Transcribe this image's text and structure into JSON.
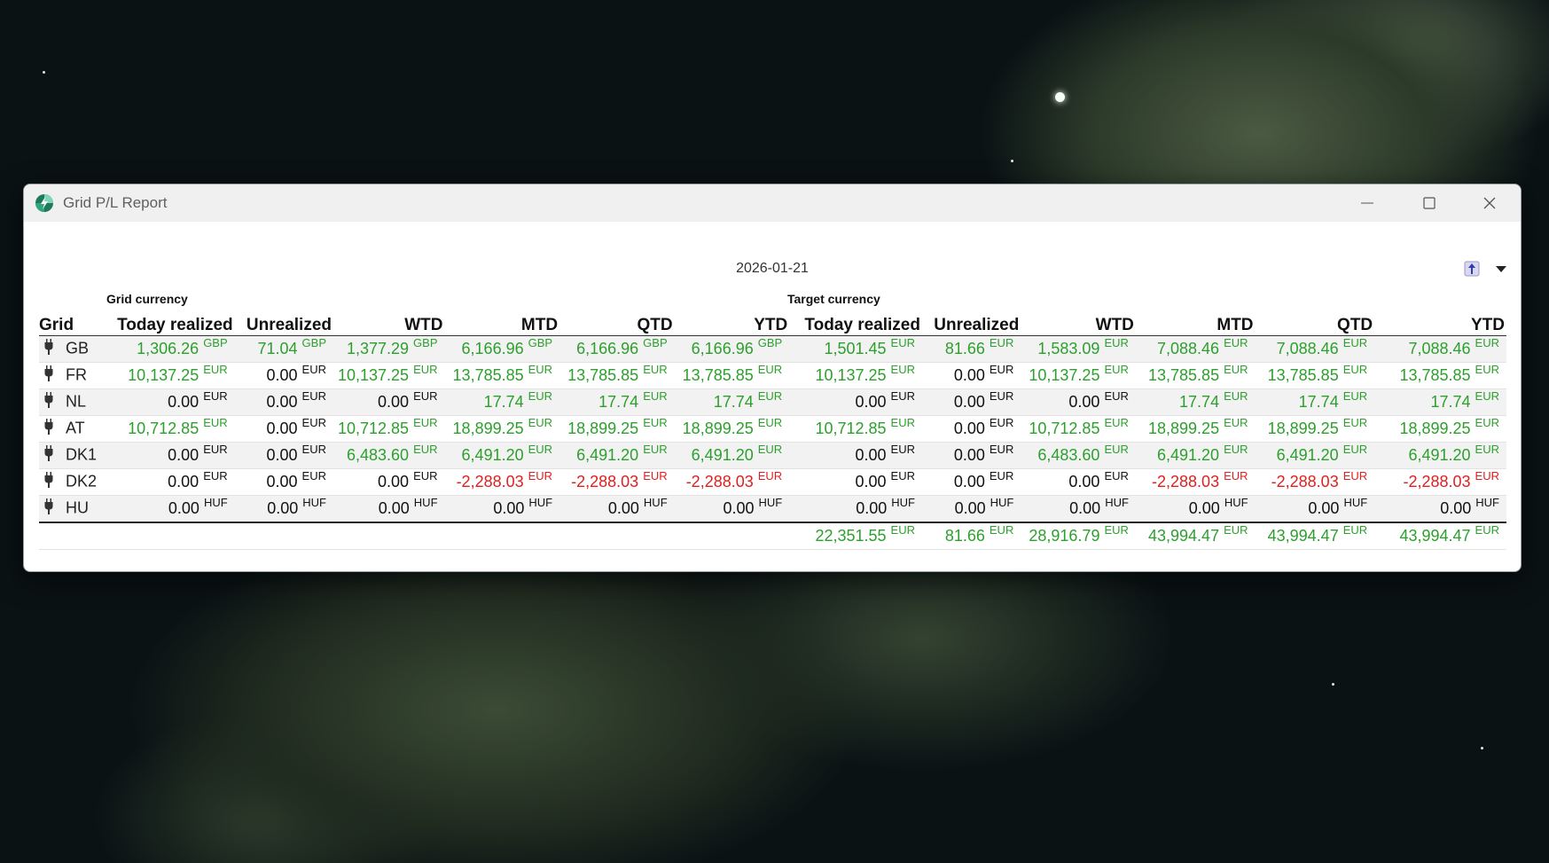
{
  "window": {
    "title": "Grid P/L Report"
  },
  "report_date": "2026-01-21",
  "groups": {
    "grid_currency": "Grid currency",
    "target_currency": "Target currency"
  },
  "columns": [
    "Grid",
    "Today realized",
    "Unrealized",
    "WTD",
    "MTD",
    "QTD",
    "YTD",
    "Today realized",
    "Unrealized",
    "WTD",
    "MTD",
    "QTD",
    "YTD"
  ],
  "colors": {
    "positive": "#2ca02c",
    "negative": "#e02020",
    "zero": "#111111"
  },
  "rows": [
    {
      "grid": "GB",
      "gc": "GBP",
      "tc": "EUR",
      "values": [
        "1,306.26",
        "71.04",
        "1,377.29",
        "6,166.96",
        "6,166.96",
        "6,166.96",
        "1,501.45",
        "81.66",
        "1,583.09",
        "7,088.46",
        "7,088.46",
        "7,088.46"
      ]
    },
    {
      "grid": "FR",
      "gc": "EUR",
      "tc": "EUR",
      "values": [
        "10,137.25",
        "0.00",
        "10,137.25",
        "13,785.85",
        "13,785.85",
        "13,785.85",
        "10,137.25",
        "0.00",
        "10,137.25",
        "13,785.85",
        "13,785.85",
        "13,785.85"
      ]
    },
    {
      "grid": "NL",
      "gc": "EUR",
      "tc": "EUR",
      "values": [
        "0.00",
        "0.00",
        "0.00",
        "17.74",
        "17.74",
        "17.74",
        "0.00",
        "0.00",
        "0.00",
        "17.74",
        "17.74",
        "17.74"
      ]
    },
    {
      "grid": "AT",
      "gc": "EUR",
      "tc": "EUR",
      "values": [
        "10,712.85",
        "0.00",
        "10,712.85",
        "18,899.25",
        "18,899.25",
        "18,899.25",
        "10,712.85",
        "0.00",
        "10,712.85",
        "18,899.25",
        "18,899.25",
        "18,899.25"
      ]
    },
    {
      "grid": "DK1",
      "gc": "EUR",
      "tc": "EUR",
      "values": [
        "0.00",
        "0.00",
        "6,483.60",
        "6,491.20",
        "6,491.20",
        "6,491.20",
        "0.00",
        "0.00",
        "6,483.60",
        "6,491.20",
        "6,491.20",
        "6,491.20"
      ]
    },
    {
      "grid": "DK2",
      "gc": "EUR",
      "tc": "EUR",
      "values": [
        "0.00",
        "0.00",
        "0.00",
        "-2,288.03",
        "-2,288.03",
        "-2,288.03",
        "0.00",
        "0.00",
        "0.00",
        "-2,288.03",
        "-2,288.03",
        "-2,288.03"
      ]
    },
    {
      "grid": "HU",
      "gc": "HUF",
      "tc": "HUF",
      "values": [
        "0.00",
        "0.00",
        "0.00",
        "0.00",
        "0.00",
        "0.00",
        "0.00",
        "0.00",
        "0.00",
        "0.00",
        "0.00",
        "0.00"
      ]
    }
  ],
  "totals": {
    "currency": "EUR",
    "values": [
      "22,351.55",
      "81.66",
      "28,916.79",
      "43,994.47",
      "43,994.47",
      "43,994.47"
    ]
  },
  "icons": {
    "app": "app-logo-icon",
    "plug": "plug-icon",
    "toolbar": "export-icon",
    "caret": "dropdown-caret-icon"
  }
}
